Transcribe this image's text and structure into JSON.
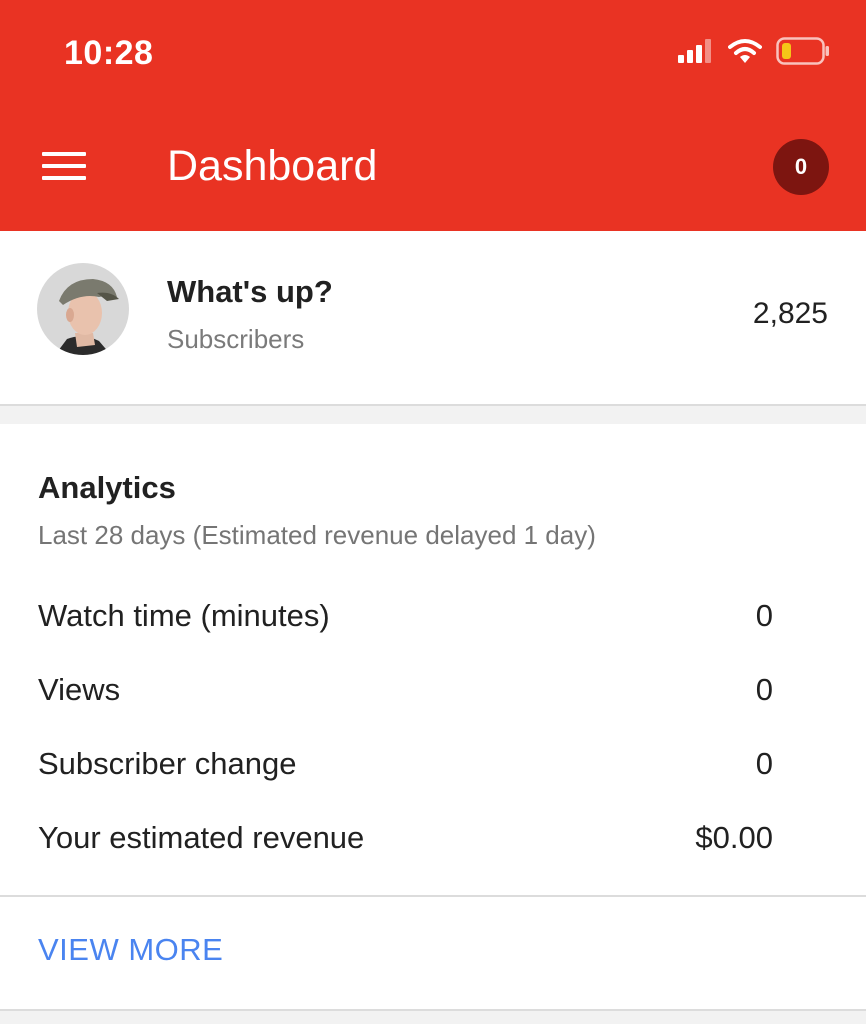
{
  "status_bar": {
    "time": "10:28"
  },
  "app_bar": {
    "title": "Dashboard",
    "notification_count": "0",
    "icons": [
      "menu-icon",
      "cell-signal-icon",
      "wifi-icon",
      "battery-icon"
    ]
  },
  "channel": {
    "name": "What's up?",
    "subscribers_label": "Subscribers",
    "subscriber_count": "2,825"
  },
  "analytics": {
    "title": "Analytics",
    "subtitle": "Last 28 days (Estimated revenue delayed 1 day)",
    "metrics": [
      {
        "label": "Watch time (minutes)",
        "value": "0"
      },
      {
        "label": "Views",
        "value": "0"
      },
      {
        "label": "Subscriber change",
        "value": "0"
      },
      {
        "label": "Your estimated revenue",
        "value": "$0.00"
      }
    ],
    "view_more_label": "VIEW MORE"
  },
  "colors": {
    "header": "#e93323",
    "badge": "#7d1510",
    "link": "#4a84f0",
    "battery_low": "#f5c518"
  }
}
